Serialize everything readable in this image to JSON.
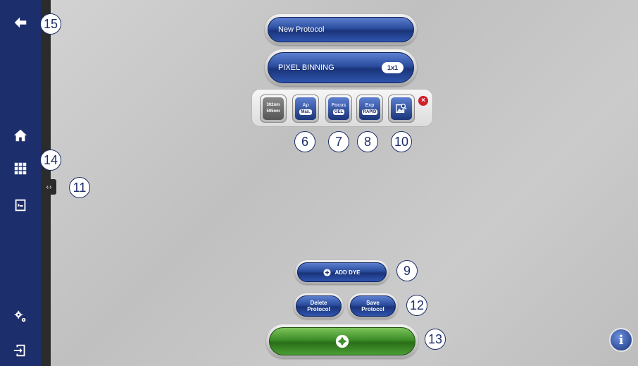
{
  "sidebar": {
    "items": [
      {
        "name": "back-arrow-icon"
      },
      {
        "name": "home-icon"
      },
      {
        "name": "grid-icon"
      },
      {
        "name": "image-editor-icon"
      },
      {
        "name": "settings-gears-icon"
      },
      {
        "name": "logout-icon"
      }
    ],
    "handle_glyph": "‹·›"
  },
  "protocol": {
    "name": "New Protocol"
  },
  "binning": {
    "label": "PIXEL BINNING",
    "value": "1x1"
  },
  "tools": {
    "wavelength": {
      "top": "302nm",
      "bottom": "595nm"
    },
    "aperture": {
      "top": "Ap",
      "value": "Max."
    },
    "focus": {
      "top": "Focus",
      "value": "GEL"
    },
    "exposure": {
      "top": "Exp",
      "value": "RAPID"
    },
    "close_glyph": "×"
  },
  "buttons": {
    "add_dye": "ADD DYE",
    "delete_line1": "Delete",
    "delete_line2": "Protocol",
    "save_line1": "Save",
    "save_line2": "Protocol",
    "info_glyph": "i"
  },
  "callouts": {
    "c15": "15",
    "c14": "14",
    "c11": "11",
    "c6": "6",
    "c7": "7",
    "c8": "8",
    "c10": "10",
    "c9": "9",
    "c12": "12",
    "c13": "13"
  },
  "colors": {
    "sidebar": "#1c2e6b",
    "accent_blue": "#2a4c9d",
    "capture_green": "#3c8c28",
    "close_red": "#d0202a"
  }
}
